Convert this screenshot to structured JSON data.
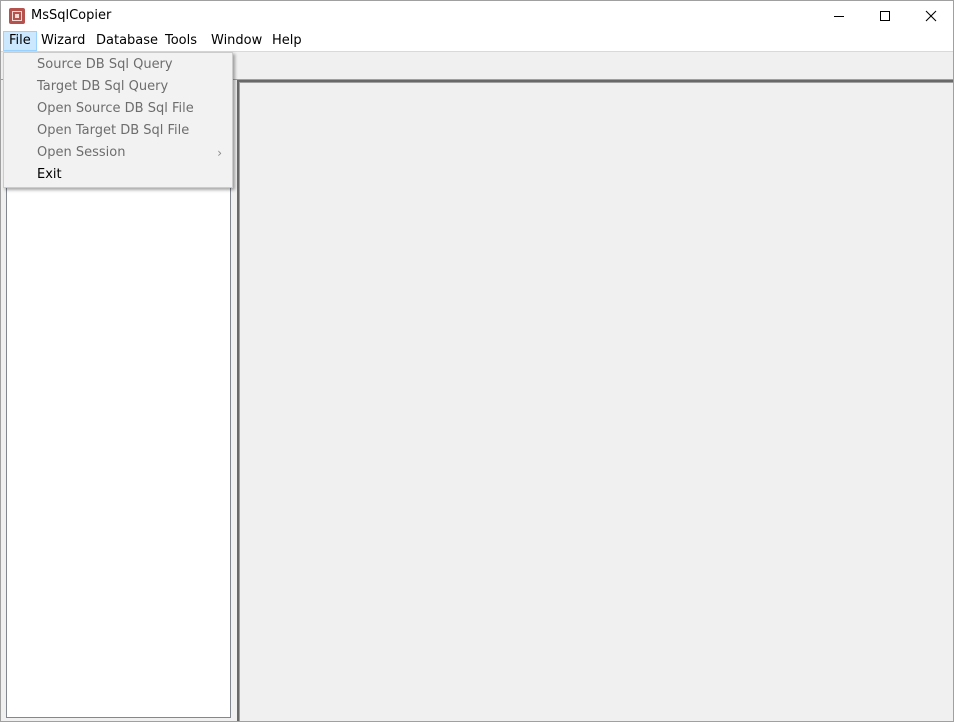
{
  "window": {
    "title": "MsSqlCopier",
    "icon": "app-logo-icon"
  },
  "title_buttons": {
    "minimize_icon": "minimize-icon",
    "maximize_icon": "maximize-icon",
    "close_icon": "close-icon"
  },
  "menu": {
    "items": [
      {
        "label": "File",
        "active": true
      },
      {
        "label": "Wizard"
      },
      {
        "label": "Database"
      },
      {
        "label": "Tools"
      },
      {
        "label": "Window"
      },
      {
        "label": "Help"
      }
    ]
  },
  "file_menu": {
    "items": [
      {
        "label": "Source DB Sql Query",
        "enabled": false
      },
      {
        "label": "Target DB Sql Query",
        "enabled": false
      },
      {
        "label": "Open Source DB Sql File",
        "enabled": false
      },
      {
        "label": "Open Target DB Sql File",
        "enabled": false
      },
      {
        "label": "Open Session",
        "enabled": false,
        "submenu_arrow": "›"
      },
      {
        "label": "Exit",
        "enabled": true
      }
    ]
  }
}
